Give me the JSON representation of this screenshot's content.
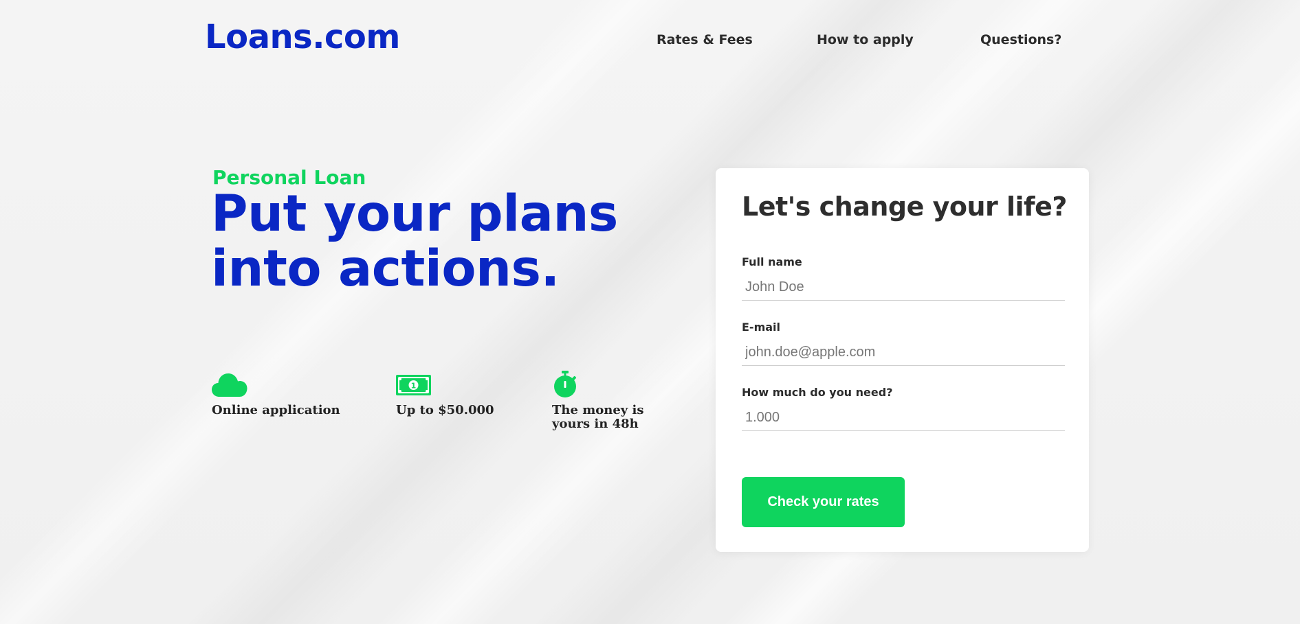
{
  "brand": {
    "logo": "Loans.com",
    "primary_color": "#0a27c4",
    "accent_color": "#0fd45e"
  },
  "nav": {
    "items": [
      {
        "label": "Rates & Fees"
      },
      {
        "label": "How to apply"
      },
      {
        "label": "Questions?"
      }
    ]
  },
  "hero": {
    "eyebrow": "Personal Loan",
    "headline_line1": "Put your plans",
    "headline_line2": "into actions."
  },
  "features": [
    {
      "icon": "cloud-icon",
      "label": "Online application"
    },
    {
      "icon": "money-bill-icon",
      "label": "Up to $50.000"
    },
    {
      "icon": "stopwatch-icon",
      "label_line1": "The money is",
      "label_line2": "yours in 48h"
    }
  ],
  "form": {
    "title": "Let's change your life?",
    "fields": [
      {
        "label": "Full name",
        "placeholder": "John Doe",
        "value": ""
      },
      {
        "label": "E-mail",
        "placeholder": "john.doe@apple.com",
        "value": ""
      },
      {
        "label": "How much do you need?",
        "placeholder": "1.000",
        "value": ""
      }
    ],
    "submit_label": "Check your rates"
  }
}
